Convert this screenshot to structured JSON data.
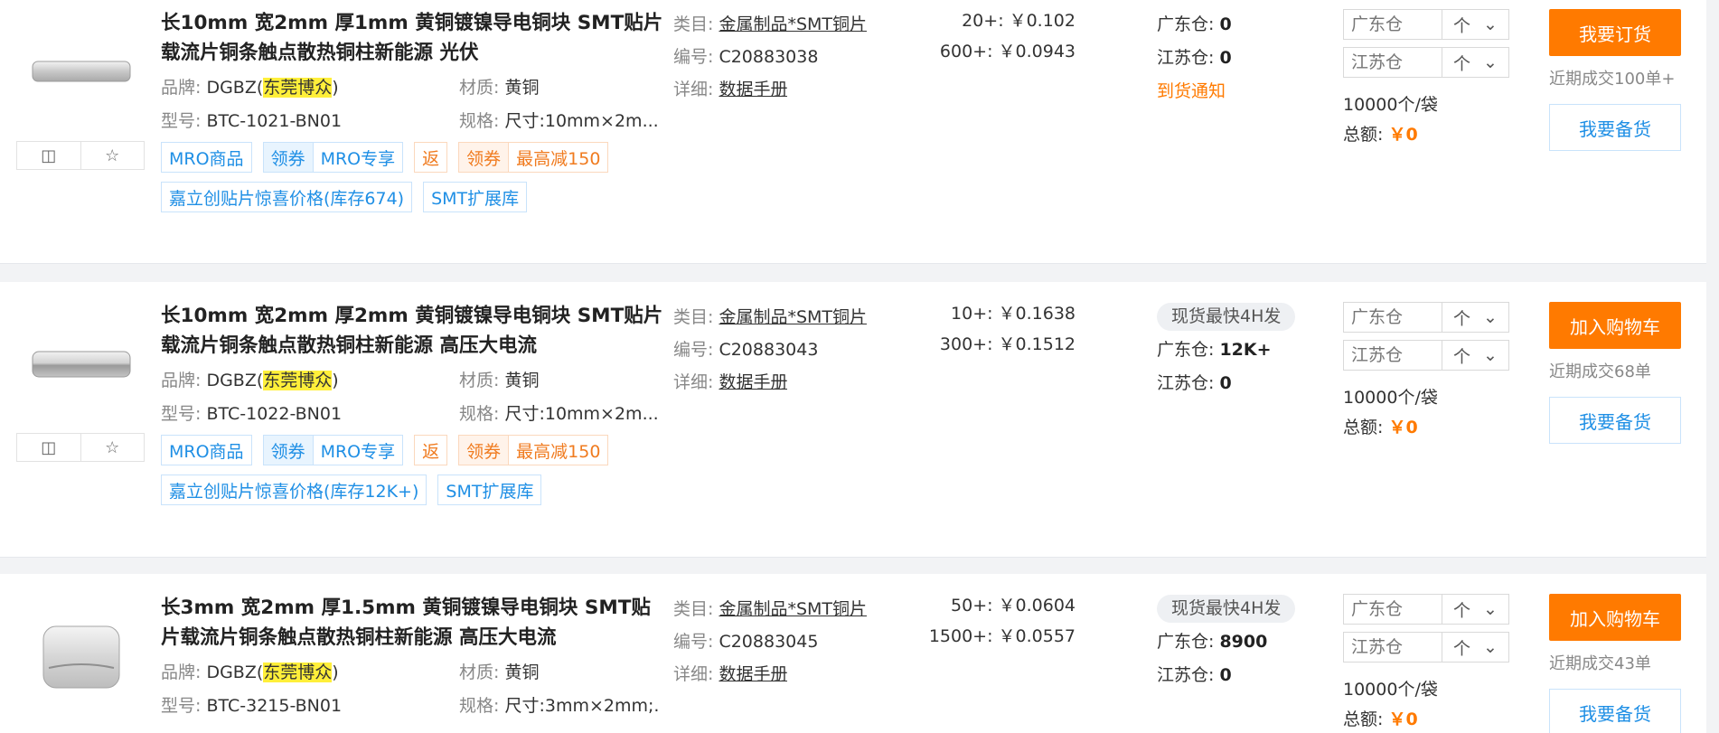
{
  "products": [
    {
      "title": "长10mm 宽2mm 厚1mm 黄铜镀镍导电铜块 SMT贴片载流片铜条触点散热铜柱新能源 光伏",
      "brand_label": "品牌:",
      "brand_prefix": "DGBZ(",
      "brand_highlight": "东莞博众",
      "brand_suffix": ")",
      "model_label": "型号:",
      "model": "BTC-1021-BN01",
      "material_label": "材质:",
      "material": "黄铜",
      "spec_label": "规格:",
      "spec": "尺寸:10mm×2m...",
      "category_label": "类目:",
      "category": "金属制品*SMT铜片",
      "code_label": "编号:",
      "code": "C20883038",
      "detail_label": "详细:",
      "detail": "数据手册",
      "tags": {
        "mro": "MRO商品",
        "coupon": "领券",
        "mro_special": "MRO专享",
        "rebate": "返",
        "coupon2": "领券",
        "discount": "最高减150",
        "promo": "嘉立创贴片惊喜价格(库存674)",
        "smt": "SMT扩展库"
      },
      "prices": [
        {
          "qty": "20+:",
          "price": "￥0.102"
        },
        {
          "qty": "600+:",
          "price": "￥0.0943"
        }
      ],
      "stock_badge": "",
      "gd_label": "广东仓:",
      "gd_value": "0",
      "js_label": "江苏仓:",
      "js_value": "0",
      "notify": "到货通知",
      "gd_placeholder": "广东仓",
      "js_placeholder": "江苏仓",
      "unit": "个",
      "pack": "10000个/袋",
      "total_label": "总额:",
      "total_value": "￥0",
      "primary_btn": "我要订货",
      "recent": "近期成交100单+",
      "secondary_btn": "我要备货"
    },
    {
      "title": "长10mm 宽2mm 厚2mm 黄铜镀镍导电铜块 SMT贴片载流片铜条触点散热铜柱新能源 高压大电流",
      "brand_label": "品牌:",
      "brand_prefix": "DGBZ(",
      "brand_highlight": "东莞博众",
      "brand_suffix": ")",
      "model_label": "型号:",
      "model": "BTC-1022-BN01",
      "material_label": "材质:",
      "material": "黄铜",
      "spec_label": "规格:",
      "spec": "尺寸:10mm×2m...",
      "category_label": "类目:",
      "category": "金属制品*SMT铜片",
      "code_label": "编号:",
      "code": "C20883043",
      "detail_label": "详细:",
      "detail": "数据手册",
      "tags": {
        "mro": "MRO商品",
        "coupon": "领券",
        "mro_special": "MRO专享",
        "rebate": "返",
        "coupon2": "领券",
        "discount": "最高减150",
        "promo": "嘉立创贴片惊喜价格(库存12K+)",
        "smt": "SMT扩展库"
      },
      "prices": [
        {
          "qty": "10+:",
          "price": "￥0.1638"
        },
        {
          "qty": "300+:",
          "price": "￥0.1512"
        }
      ],
      "stock_badge": "现货最快4H发",
      "gd_label": "广东仓:",
      "gd_value": "12K+",
      "js_label": "江苏仓:",
      "js_value": "0",
      "notify": "",
      "gd_placeholder": "广东仓",
      "js_placeholder": "江苏仓",
      "unit": "个",
      "pack": "10000个/袋",
      "total_label": "总额:",
      "total_value": "￥0",
      "primary_btn": "加入购物车",
      "recent": "近期成交68单",
      "secondary_btn": "我要备货"
    },
    {
      "title": "长3mm 宽2mm 厚1.5mm 黄铜镀镍导电铜块 SMT贴片载流片铜条触点散热铜柱新能源 高压大电流",
      "brand_label": "品牌:",
      "brand_prefix": "DGBZ(",
      "brand_highlight": "东莞博众",
      "brand_suffix": ")",
      "model_label": "型号:",
      "model": "BTC-3215-BN01",
      "material_label": "材质:",
      "material": "黄铜",
      "spec_label": "规格:",
      "spec": "尺寸:3mm×2mm;...",
      "category_label": "类目:",
      "category": "金属制品*SMT铜片",
      "code_label": "编号:",
      "code": "C20883045",
      "detail_label": "详细:",
      "detail": "数据手册",
      "prices": [
        {
          "qty": "50+:",
          "price": "￥0.0604"
        },
        {
          "qty": "1500+:",
          "price": "￥0.0557"
        }
      ],
      "stock_badge": "现货最快4H发",
      "gd_label": "广东仓:",
      "gd_value": "8900",
      "js_label": "江苏仓:",
      "js_value": "0",
      "gd_placeholder": "广东仓",
      "js_placeholder": "江苏仓",
      "unit": "个",
      "pack": "10000个/袋",
      "total_label": "总额:",
      "total_value": "￥0",
      "primary_btn": "加入购物车",
      "recent": "近期成交43单",
      "secondary_btn": "我要备货"
    }
  ],
  "icons": {
    "compare": "compare-icon",
    "favorite": "star-icon",
    "chevron": "chevron-down-icon",
    "image": "copper-block-image"
  }
}
